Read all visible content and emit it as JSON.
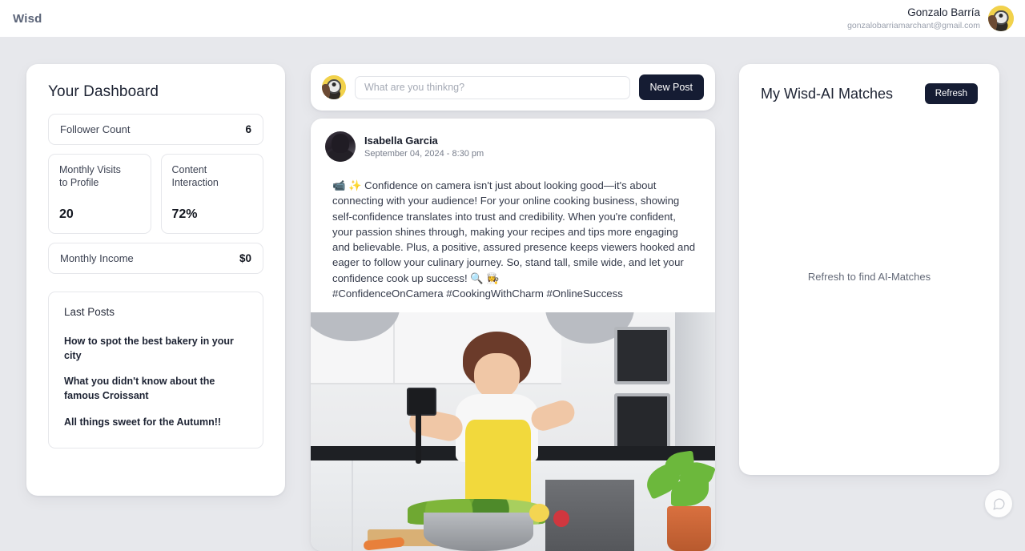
{
  "topbar": {
    "brand": "Wisd",
    "user_name": "Gonzalo Barría",
    "user_email": "gonzalobarriamarchant@gmail.com",
    "avatar_icon": "minion-avatar"
  },
  "dashboard": {
    "title": "Your Dashboard",
    "follower": {
      "label": "Follower Count",
      "value": "6"
    },
    "visits": {
      "label": "Monthly Visits\nto Profile",
      "label_line1": "Monthly Visits",
      "label_line2": "to Profile",
      "value": "20"
    },
    "interaction": {
      "label_line1": "Content",
      "label_line2": "Interaction",
      "value": "72%"
    },
    "income": {
      "label": "Monthly Income",
      "value": "$0"
    },
    "last_posts": {
      "title": "Last Posts",
      "items": [
        "How to spot the best bakery in your city",
        "What you didn't know about the famous Croissant",
        "All things sweet for the Autumn!!"
      ]
    }
  },
  "composer": {
    "placeholder": "What are you thinkng?",
    "value": "",
    "new_post_label": "New Post",
    "avatar_icon": "minion-avatar"
  },
  "post": {
    "author": "Isabella Garcia",
    "date": "September 04, 2024 - 8:30 pm",
    "avatar_icon": "person-avatar",
    "body": "📹 ✨ Confidence on camera isn't just about looking good—it's about connecting with your audience! For your online cooking business, showing self-confidence translates into trust and credibility. When you're confident, your passion shines through, making your recipes and tips more engaging and believable. Plus, a positive, assured presence keeps viewers hooked and eager to follow your culinary journey. So, stand tall, smile wide, and let your confidence cook up success! 🔍 👩‍🍳",
    "hashtags": "#ConfidenceOnCamera #CookingWithCharm #OnlineSuccess",
    "image_alt": "Woman in yellow apron filming herself cooking in a kitchen"
  },
  "matches": {
    "title": "My Wisd-AI Matches",
    "refresh_label": "Refresh",
    "empty_text": "Refresh to find AI-Matches"
  },
  "fab": {
    "icon": "chat-bubble-icon"
  },
  "colors": {
    "page_background": "#e7e8ec",
    "card_background": "#ffffff",
    "accent_dark": "#151c33",
    "brand_text": "#5b6478",
    "muted_text": "#777d8b"
  }
}
